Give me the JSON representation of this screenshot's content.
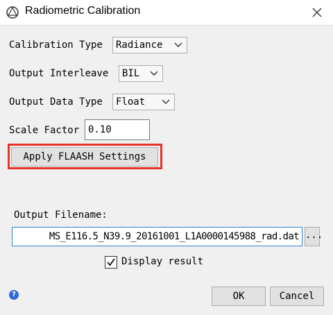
{
  "window": {
    "title": "Radiometric Calibration",
    "icons": {
      "app": "envi-app-icon",
      "close": "close-icon"
    }
  },
  "fields": {
    "calibration_type": {
      "label": "Calibration Type",
      "value": "Radiance"
    },
    "output_interleave": {
      "label": "Output Interleave",
      "value": "BIL"
    },
    "output_data_type": {
      "label": "Output Data Type",
      "value": "Float"
    },
    "scale_factor": {
      "label": "Scale Factor",
      "value": "0.10"
    }
  },
  "apply_flaash_button": "Apply FLAASH Settings",
  "output": {
    "label": "Output Filename:",
    "value": "MS_E116.5_N39.9_20161001_L1A0000145988_rad.dat",
    "browse_label": "..."
  },
  "display_result": {
    "label": "Display result",
    "checked": true
  },
  "help_icon_glyph": "?",
  "buttons": {
    "ok": "OK",
    "cancel": "Cancel"
  },
  "colors": {
    "highlight": "#e8312b",
    "help": "#2e6bd6"
  }
}
